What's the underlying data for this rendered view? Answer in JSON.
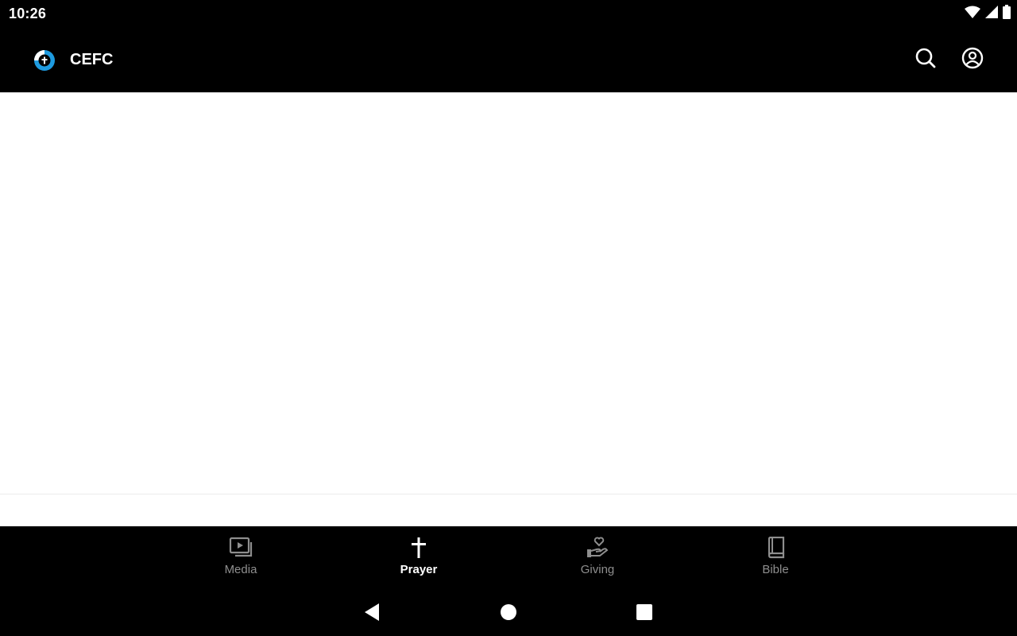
{
  "status_bar": {
    "time": "10:26",
    "icons": [
      "wifi-icon",
      "cell-signal-icon",
      "battery-icon"
    ]
  },
  "app_bar": {
    "title": "CEFC",
    "logo_icon": "cefc-logo-icon",
    "actions": [
      "search-icon",
      "account-circle-icon"
    ]
  },
  "bottom_nav": {
    "items": [
      {
        "label": "Media",
        "icon": "video-library-icon",
        "active": false
      },
      {
        "label": "Prayer",
        "icon": "cross-icon",
        "active": true
      },
      {
        "label": "Giving",
        "icon": "hand-heart-icon",
        "active": false
      },
      {
        "label": "Bible",
        "icon": "book-icon",
        "active": false
      }
    ]
  },
  "system_nav": {
    "buttons": [
      "back-icon",
      "home-icon",
      "recents-icon"
    ]
  },
  "colors": {
    "bar_background": "#000000",
    "content_background": "#ffffff",
    "active_label": "#ffffff",
    "inactive_label": "#8e8e8e",
    "logo_accent": "#1e9be0"
  }
}
